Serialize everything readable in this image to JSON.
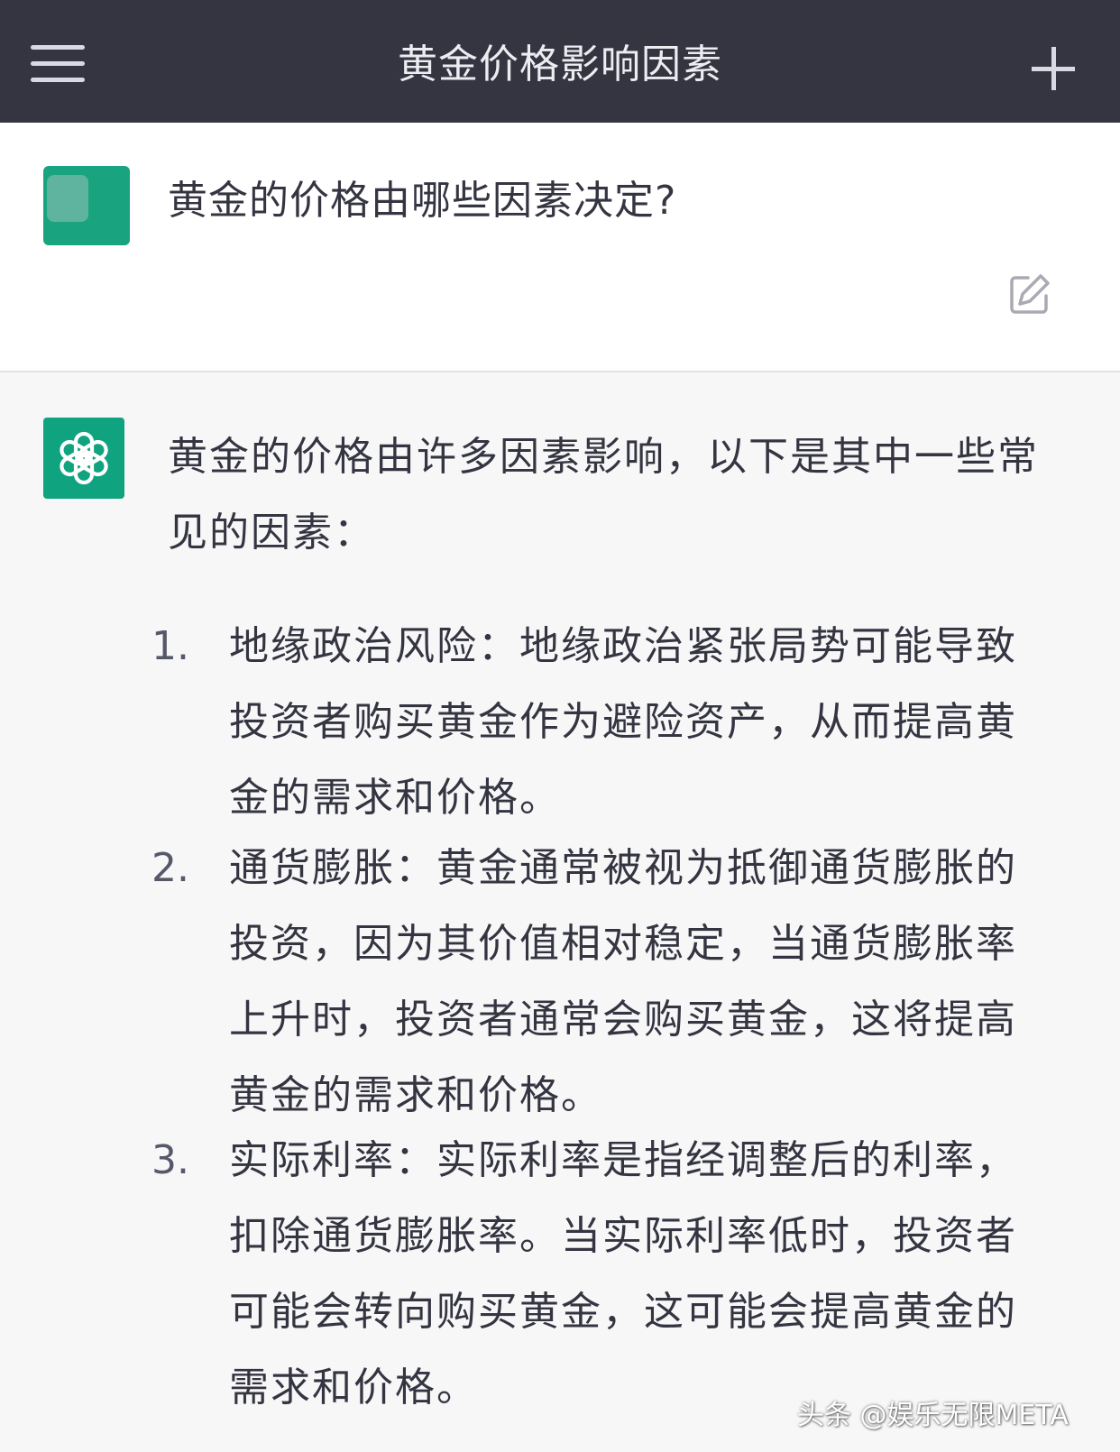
{
  "header": {
    "title": "黄金价格影响因素",
    "menu_icon": "hamburger-icon",
    "new_chat_icon": "plus-icon"
  },
  "user_message": {
    "text": "黄金的价格由哪些因素决定?",
    "edit_icon": "edit-icon"
  },
  "assistant_message": {
    "intro": "黄金的价格由许多因素影响，以下是其中一些常见的因素：",
    "items": [
      {
        "num": "1.",
        "text": "地缘政治风险：地缘政治紧张局势可能导致投资者购买黄金作为避险资产，从而提高黄金的需求和价格。"
      },
      {
        "num": "2.",
        "text": "通货膨胀：黄金通常被视为抵御通货膨胀的投资，因为其价值相对稳定，当通货膨胀率上升时，投资者通常会购买黄金，这将提高黄金的需求和价格。"
      },
      {
        "num": "3.",
        "text": "实际利率：实际利率是指经调整后的利率，扣除通货膨胀率。当实际利率低时，投资者可能会转向购买黄金，这可能会提高黄金的需求和价格。"
      }
    ]
  },
  "watermark": "头条 @娱乐无限META",
  "colors": {
    "header_bg": "#343541",
    "accent_green": "#10a37f",
    "user_bg": "#ffffff",
    "assistant_bg": "#f7f7f8",
    "text": "#343541"
  }
}
